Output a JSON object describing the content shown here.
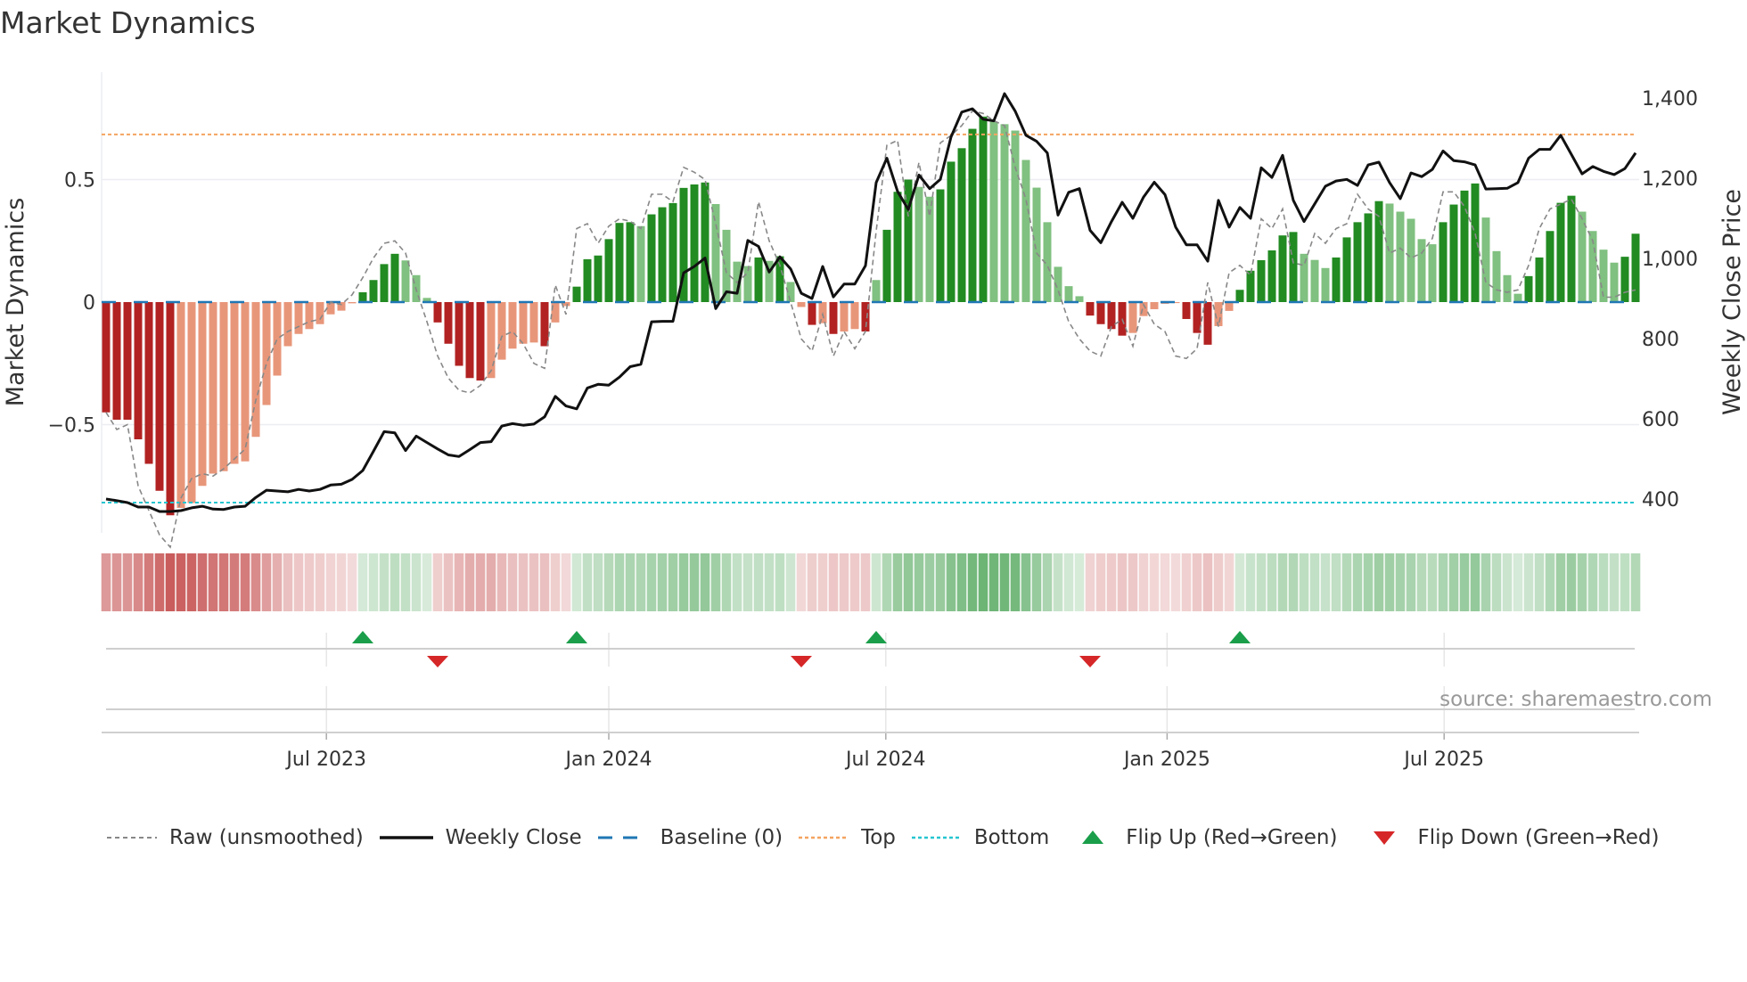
{
  "title": "Market Dynamics",
  "source": "source: sharemaestro.com",
  "colors": {
    "bar_dark_red": "#b22222",
    "bar_light_red": "#e8967a",
    "bar_dark_green": "#228b22",
    "bar_light_green": "#80c080",
    "baseline": "#1f77b4",
    "top": "#f4a460",
    "bottom": "#26c6d0",
    "raw": "#888888",
    "close": "#111111",
    "flip_up": "#1a9e4a",
    "flip_down": "#d62728"
  },
  "legend": {
    "raw": "Raw (unsmoothed)",
    "close": "Weekly Close",
    "baseline": "Baseline (0)",
    "top": "Top",
    "bottom": "Bottom",
    "flip_up": "Flip Up (Red→Green)",
    "flip_down": "Flip Down (Green→Red)"
  },
  "chart_data": {
    "type": "bar",
    "title": "Market Dynamics",
    "ylabel": "Market Dynamics",
    "y2label": "Weekly Close Price",
    "ylim": [
      -0.93,
      0.95
    ],
    "y2lim": [
      310,
      1460
    ],
    "yticks": [
      {
        "v": 0.5,
        "label": "0.5"
      },
      {
        "v": 0,
        "label": "0"
      },
      {
        "v": -0.5,
        "label": "−0.5"
      }
    ],
    "y2ticks": [
      {
        "v": 1400,
        "label": "1,400"
      },
      {
        "v": 1200,
        "label": "1,200"
      },
      {
        "v": 1000,
        "label": "1,000"
      },
      {
        "v": 800,
        "label": "800"
      },
      {
        "v": 600,
        "label": "600"
      },
      {
        "v": 400,
        "label": "400"
      }
    ],
    "xticks": [
      {
        "week": 20.6,
        "label": "Jul 2023"
      },
      {
        "week": 47.0,
        "label": "Jan 2024"
      },
      {
        "week": 72.9,
        "label": "Jul 2024"
      },
      {
        "week": 99.2,
        "label": "Jan 2025"
      },
      {
        "week": 125.1,
        "label": "Jul 2025"
      }
    ],
    "top_level": 0.684,
    "bottom_level": -0.818,
    "baseline": 0,
    "dynamics": [
      -0.45,
      -0.48,
      -0.48,
      -0.56,
      -0.66,
      -0.77,
      -0.87,
      -0.84,
      -0.82,
      -0.75,
      -0.7,
      -0.69,
      -0.66,
      -0.65,
      -0.55,
      -0.42,
      -0.3,
      -0.18,
      -0.13,
      -0.11,
      -0.09,
      -0.05,
      -0.035,
      -0.005,
      0.04,
      0.09,
      0.155,
      0.197,
      0.17,
      0.11,
      0.017,
      -0.083,
      -0.17,
      -0.26,
      -0.31,
      -0.32,
      -0.31,
      -0.235,
      -0.19,
      -0.17,
      -0.165,
      -0.18,
      -0.083,
      -0.016,
      0.063,
      0.175,
      0.19,
      0.257,
      0.323,
      0.326,
      0.31,
      0.358,
      0.387,
      0.404,
      0.466,
      0.48,
      0.488,
      0.4,
      0.295,
      0.165,
      0.147,
      0.182,
      0.168,
      0.187,
      0.082,
      -0.02,
      -0.093,
      -0.086,
      -0.13,
      -0.12,
      -0.11,
      -0.12,
      0.09,
      0.295,
      0.45,
      0.5,
      0.47,
      0.43,
      0.46,
      0.573,
      0.628,
      0.707,
      0.757,
      0.736,
      0.726,
      0.7,
      0.58,
      0.467,
      0.326,
      0.144,
      0.065,
      0.024,
      -0.055,
      -0.09,
      -0.11,
      -0.137,
      -0.126,
      -0.057,
      -0.029,
      -0.007,
      -0.004,
      -0.069,
      -0.126,
      -0.174,
      -0.098,
      -0.036,
      0.05,
      0.128,
      0.171,
      0.211,
      0.272,
      0.286,
      0.197,
      0.172,
      0.139,
      0.182,
      0.264,
      0.326,
      0.362,
      0.412,
      0.402,
      0.369,
      0.34,
      0.257,
      0.236,
      0.326,
      0.398,
      0.455,
      0.484,
      0.345,
      0.208,
      0.11,
      0.034,
      0.106,
      0.182,
      0.29,
      0.405,
      0.434,
      0.369,
      0.29,
      0.214,
      0.161,
      0.185,
      0.279
    ],
    "raw": [
      -0.45,
      -0.52,
      -0.5,
      -0.75,
      -0.85,
      -0.95,
      -1.0,
      -0.8,
      -0.72,
      -0.7,
      -0.71,
      -0.68,
      -0.64,
      -0.6,
      -0.4,
      -0.25,
      -0.15,
      -0.12,
      -0.1,
      -0.08,
      -0.07,
      0.0,
      -0.01,
      0.03,
      0.1,
      0.18,
      0.24,
      0.25,
      0.2,
      0.05,
      -0.08,
      -0.22,
      -0.31,
      -0.36,
      -0.37,
      -0.34,
      -0.28,
      -0.14,
      -0.12,
      -0.17,
      -0.25,
      -0.27,
      0.07,
      -0.05,
      0.3,
      0.32,
      0.24,
      0.31,
      0.34,
      0.33,
      0.3,
      0.44,
      0.44,
      0.41,
      0.55,
      0.53,
      0.5,
      0.32,
      0.12,
      0.08,
      0.12,
      0.41,
      0.25,
      0.15,
      0.0,
      -0.15,
      -0.2,
      -0.05,
      -0.22,
      -0.12,
      -0.19,
      -0.12,
      0.29,
      0.64,
      0.66,
      0.35,
      0.57,
      0.35,
      0.65,
      0.68,
      0.72,
      0.78,
      0.77,
      0.74,
      0.72,
      0.55,
      0.42,
      0.2,
      0.15,
      0.05,
      -0.08,
      -0.15,
      -0.2,
      -0.22,
      -0.1,
      -0.07,
      -0.18,
      -0.01,
      -0.09,
      -0.12,
      -0.22,
      -0.23,
      -0.19,
      0.08,
      -0.1,
      0.12,
      0.15,
      0.11,
      0.34,
      0.3,
      0.38,
      0.16,
      0.15,
      0.28,
      0.24,
      0.3,
      0.32,
      0.44,
      0.38,
      0.35,
      0.2,
      0.22,
      0.18,
      0.2,
      0.26,
      0.45,
      0.45,
      0.39,
      0.28,
      0.08,
      0.05,
      0.04,
      0.05,
      0.15,
      0.3,
      0.38,
      0.4,
      0.42,
      0.34,
      0.25,
      0.02,
      0.02,
      0.04,
      0.05,
      0.1,
      0.3
    ],
    "weekly_close": [
      400,
      396,
      391,
      380,
      380,
      369,
      369,
      371,
      378,
      382,
      375,
      374,
      380,
      382,
      404,
      422,
      420,
      418,
      424,
      420,
      424,
      435,
      437,
      449,
      471,
      519,
      568,
      565,
      521,
      557,
      541,
      525,
      510,
      506,
      523,
      541,
      543,
      582,
      588,
      584,
      587,
      605,
      656,
      632,
      625,
      677,
      686,
      684,
      704,
      730,
      736,
      842,
      843,
      843,
      964,
      980,
      1001,
      875,
      917,
      913,
      1045,
      1030,
      966,
      1004,
      974,
      913,
      900,
      980,
      904,
      936,
      936,
      982,
      1189,
      1250,
      1167,
      1122,
      1208,
      1174,
      1197,
      1303,
      1365,
      1373,
      1347,
      1343,
      1411,
      1367,
      1307,
      1292,
      1263,
      1108,
      1165,
      1174,
      1070,
      1039,
      1092,
      1140,
      1100,
      1153,
      1190,
      1159,
      1078,
      1034,
      1034,
      993,
      1145,
      1078,
      1127,
      1100,
      1226,
      1202,
      1257,
      1145,
      1092,
      1136,
      1180,
      1193,
      1197,
      1182,
      1233,
      1240,
      1189,
      1149,
      1213,
      1204,
      1222,
      1268,
      1244,
      1241,
      1233,
      1173,
      1174,
      1175,
      1189,
      1250,
      1272,
      1272,
      1307,
      1259,
      1211,
      1229,
      1217,
      1209,
      1224,
      1263
    ],
    "flip_up_weeks": [
      24,
      44,
      72,
      106
    ],
    "flip_down_weeks": [
      31,
      65,
      92
    ]
  }
}
